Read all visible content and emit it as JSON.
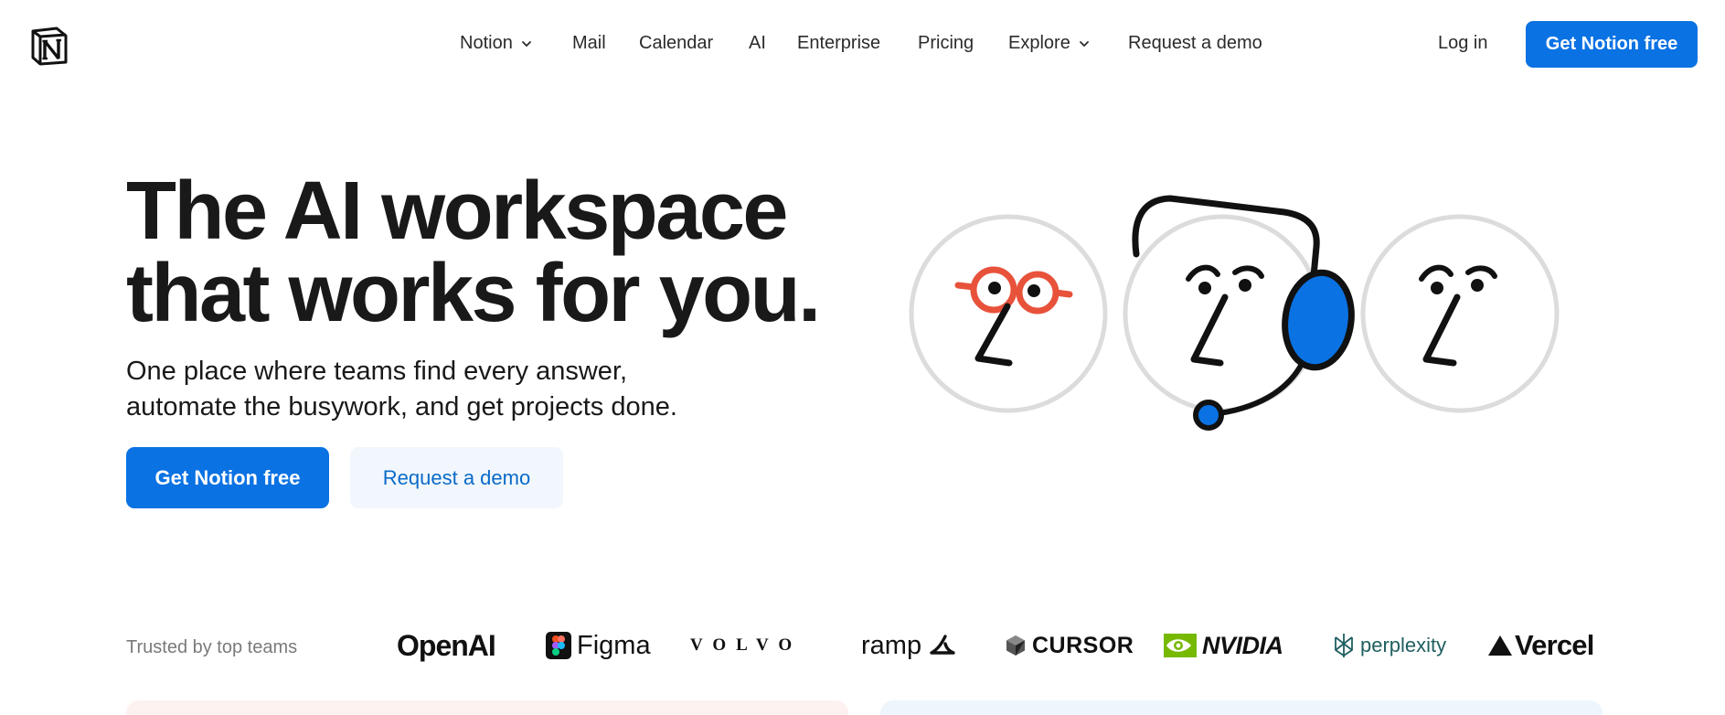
{
  "nav": {
    "logo_icon": "notion-logo-icon",
    "links": [
      {
        "label": "Notion",
        "dropdown": true
      },
      {
        "label": "Mail",
        "dropdown": false
      },
      {
        "label": "Calendar",
        "dropdown": false
      },
      {
        "label": "AI",
        "dropdown": false
      },
      {
        "label": "Enterprise",
        "dropdown": false
      },
      {
        "label": "Pricing",
        "dropdown": false
      },
      {
        "label": "Explore",
        "dropdown": true
      },
      {
        "label": "Request a demo",
        "dropdown": false
      }
    ],
    "login_label": "Log in",
    "cta_label": "Get Notion free"
  },
  "hero": {
    "title_line1": "The AI workspace",
    "title_line2": "that works for you.",
    "subtitle_line1": "One place where teams find every answer,",
    "subtitle_line2": "automate the busywork, and get projects done.",
    "primary_button": "Get Notion free",
    "secondary_button": "Request a demo"
  },
  "trusted": {
    "label": "Trusted by top teams",
    "brands": [
      "OpenAI",
      "Figma",
      "VOLVO",
      "ramp",
      "CURSOR",
      "NVIDIA",
      "perplexity",
      "Vercel"
    ]
  },
  "colors": {
    "accent": "#0a72e3",
    "secondary_bg": "#f1f7fc",
    "glasses_red": "#e8523b"
  }
}
